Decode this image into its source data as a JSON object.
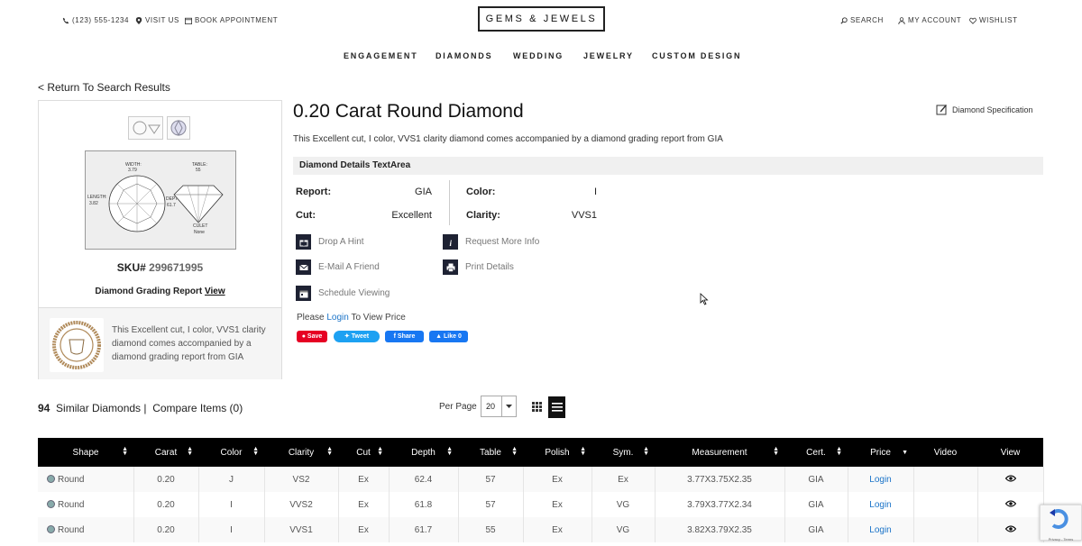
{
  "topbar": {
    "phone": "(123) 555-1234",
    "visit": "VISIT US",
    "appointment": "BOOK APPOINTMENT",
    "logo": "GEMS & JEWELS",
    "search": "SEARCH",
    "account": "MY ACCOUNT",
    "wishlist": "WISHLIST"
  },
  "nav": [
    "ENGAGEMENT",
    "DIAMONDS",
    "WEDDING",
    "JEWELRY",
    "CUSTOM DESIGN"
  ],
  "back_link": "< Return To Search Results",
  "left": {
    "sku_label": "SKU#",
    "sku_value": "299671995",
    "grading_text": "Diamond Grading Report",
    "grading_link": "View",
    "cert_desc": "This Excellent cut, I color, VVS1 clarity diamond comes accompanied by a diamond grading report from GIA",
    "diagram": {
      "width_label": "WIDTH:",
      "width_val": "3.79",
      "table_label": "TABLE:",
      "table_val": "55",
      "length_label": "LENGTH:",
      "length_val": "3.82",
      "depth_label": "DEPTH:",
      "depth_val": "61.7",
      "culet_label": "CULET",
      "culet_val": "None"
    }
  },
  "product": {
    "title": "0.20 Carat Round Diamond",
    "description": "This Excellent cut, I color, VVS1 clarity diamond comes accompanied by a diamond grading report from GIA",
    "spec_link": "Diamond Specification",
    "details_heading": "Diamond Details TextArea",
    "report_label": "Report:",
    "report_val": "GIA",
    "cut_label": "Cut:",
    "cut_val": "Excellent",
    "color_label": "Color:",
    "color_val": "I",
    "clarity_label": "Clarity:",
    "clarity_val": "VVS1"
  },
  "actions": {
    "hint": "Drop A Hint",
    "email": "E-Mail A Friend",
    "schedule": "Schedule Viewing",
    "request": "Request More Info",
    "print": "Print Details"
  },
  "price": {
    "prefix": "Please",
    "link": "Login",
    "suffix": "To View Price"
  },
  "social": {
    "save": "Save",
    "tweet": "Tweet",
    "share": "Share",
    "like": "Like 0"
  },
  "similar": {
    "count": "94",
    "label": "Similar Diamonds |",
    "compare": "Compare Items (0)",
    "per_page_label": "Per Page",
    "per_page_value": "20"
  },
  "table": {
    "headers": [
      "Shape",
      "Carat",
      "Color",
      "Clarity",
      "Cut",
      "Depth",
      "Table",
      "Polish",
      "Sym.",
      "Measurement",
      "Cert.",
      "Price",
      "Video",
      "View"
    ],
    "rows": [
      [
        "Round",
        "0.20",
        "J",
        "VS2",
        "Ex",
        "62.4",
        "57",
        "Ex",
        "Ex",
        "3.77X3.75X2.35",
        "GIA",
        "Login"
      ],
      [
        "Round",
        "0.20",
        "I",
        "VVS2",
        "Ex",
        "61.8",
        "57",
        "Ex",
        "VG",
        "3.79X3.77X2.34",
        "GIA",
        "Login"
      ],
      [
        "Round",
        "0.20",
        "I",
        "VVS1",
        "Ex",
        "61.7",
        "55",
        "Ex",
        "VG",
        "3.82X3.79X2.35",
        "GIA",
        "Login"
      ]
    ]
  },
  "recaptcha": {
    "links": "Privacy - Terms"
  }
}
